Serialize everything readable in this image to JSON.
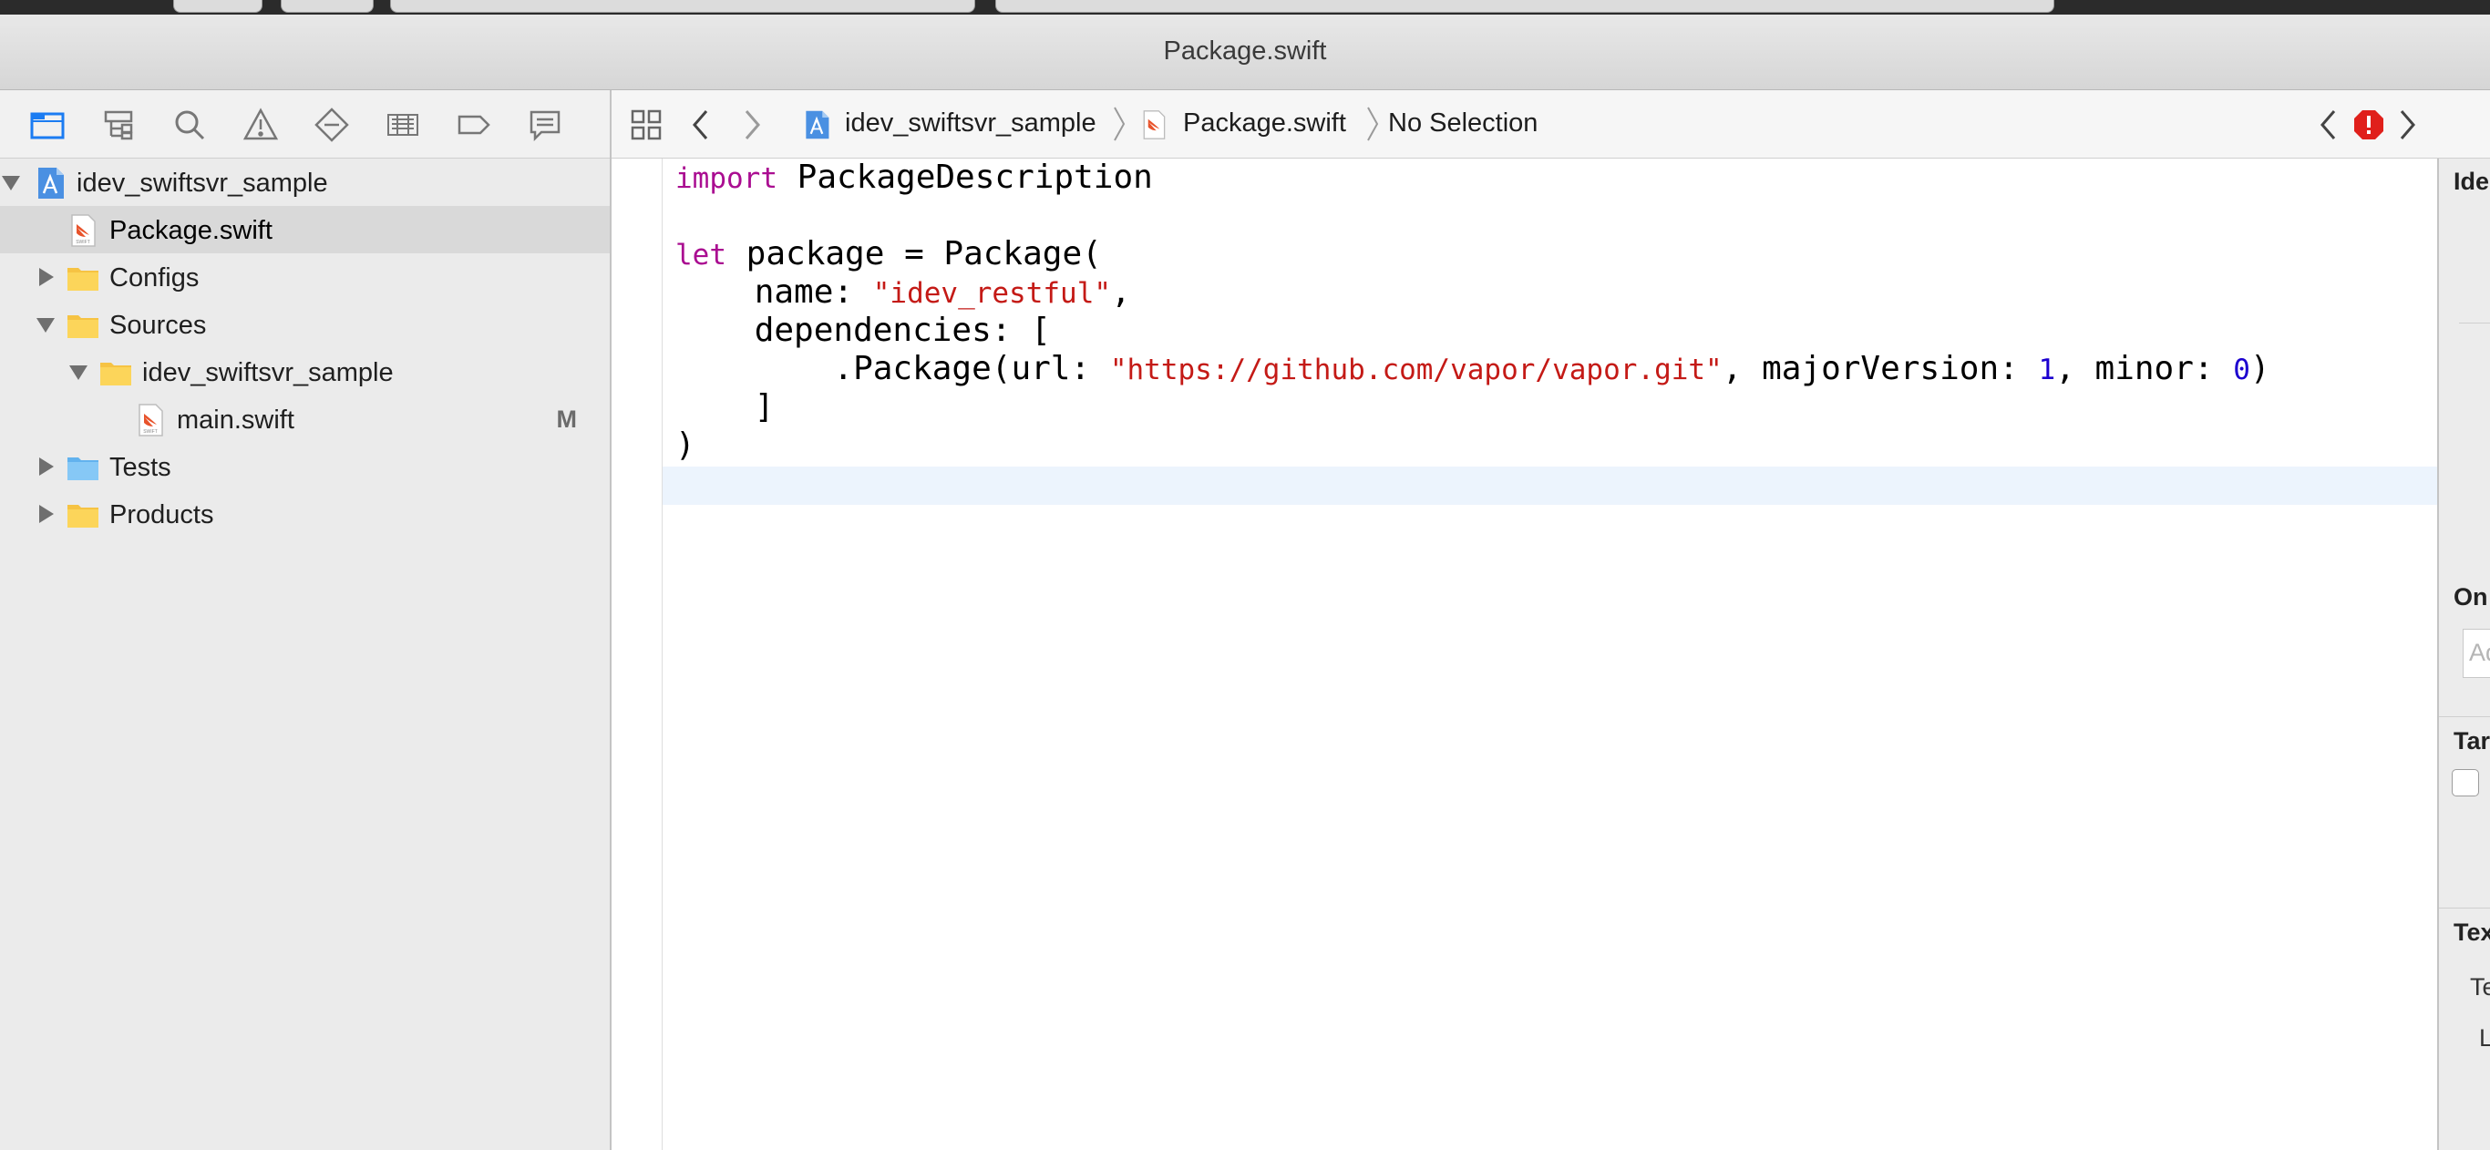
{
  "window": {
    "title": "Package.swift"
  },
  "navigator": {
    "toolbar_icons": [
      "project-navigator-icon",
      "symbol-navigator-icon",
      "find-navigator-icon",
      "issue-navigator-icon",
      "test-navigator-icon",
      "debug-navigator-icon",
      "breakpoint-navigator-icon",
      "report-navigator-icon"
    ],
    "items": [
      {
        "label": "idev_swiftsvr_sample",
        "kind": "project",
        "expanded": true
      },
      {
        "label": "Package.swift",
        "kind": "swift-file",
        "selected": true
      },
      {
        "label": "Configs",
        "kind": "folder",
        "expanded": false
      },
      {
        "label": "Sources",
        "kind": "folder",
        "expanded": true
      },
      {
        "label": "idev_swiftsvr_sample",
        "kind": "folder",
        "expanded": true
      },
      {
        "label": "main.swift",
        "kind": "swift-file",
        "badge": "M"
      },
      {
        "label": "Tests",
        "kind": "blue-folder",
        "expanded": false
      },
      {
        "label": "Products",
        "kind": "folder",
        "expanded": false
      }
    ]
  },
  "jumpbar": {
    "project": "idev_swiftsvr_sample",
    "file": "Package.swift",
    "selection": "No Selection"
  },
  "code": {
    "l1_kw": "import",
    "l1_rest": " PackageDescription",
    "l3_kw": "let",
    "l3_rest": " package = Package(",
    "l4_a": "    name: ",
    "l4_str": "\"idev_restful\"",
    "l4_b": ",",
    "l5": "    dependencies: [",
    "l6_a": "        .Package(url: ",
    "l6_str": "\"https://github.com/vapor/vapor.git\"",
    "l6_b": ", majorVersion: ",
    "l6_n1": "1",
    "l6_c": ", minor: ",
    "l6_n2": "0",
    "l6_d": ")",
    "l7": "    ]",
    "l8": ")"
  },
  "inspector": {
    "identity_header": "Ide",
    "on_demand_header": "On",
    "on_demand_placeholder": "Ad",
    "target_header": "Tar",
    "text_header": "Tex",
    "text_row1": "Te",
    "text_row2": "L"
  },
  "colors": {
    "keyword": "#aa0d91",
    "string": "#c41a16",
    "number": "#1c00cf",
    "accent": "#1b7cf2",
    "error": "#e0201b"
  }
}
